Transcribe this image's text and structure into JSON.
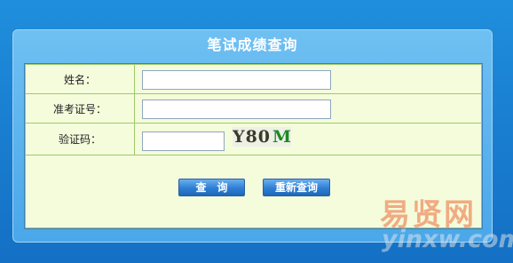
{
  "panel": {
    "title": "笔试成绩查询"
  },
  "form": {
    "name_label": "姓名：",
    "name_value": "",
    "ticket_label": "准考证号：",
    "ticket_value": "",
    "captcha_label": "验证码：",
    "captcha_value": "",
    "captcha_text_main": "Y80",
    "captcha_text_accent": "M"
  },
  "buttons": {
    "query_label": "查　询",
    "reset_label": "重新查询"
  },
  "watermark": {
    "text_cn": "易贤网",
    "text_en": "yinxw.com"
  },
  "colors": {
    "background": "#1a7fd1",
    "panel": "#4aa7e9",
    "form_fill": "#f4fcdc",
    "form_border": "#9fc96a",
    "button": "#2e7ed3",
    "watermark": "#f06a3a"
  }
}
